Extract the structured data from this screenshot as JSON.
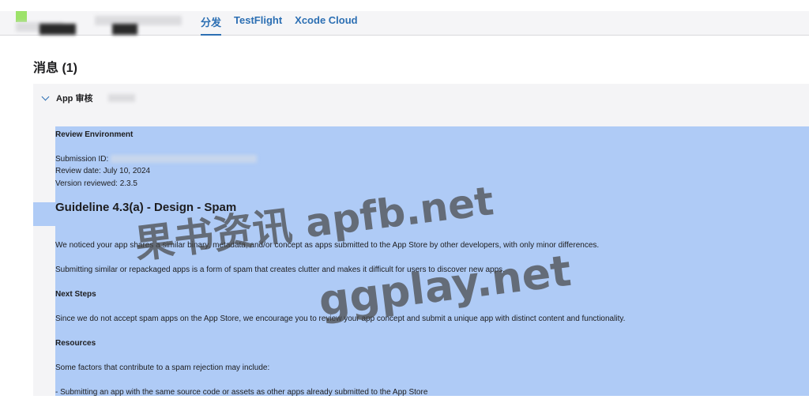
{
  "nav": {
    "tabs": [
      {
        "label": "分发",
        "active": true
      },
      {
        "label": "TestFlight",
        "active": false
      },
      {
        "label": "Xcode Cloud",
        "active": false
      }
    ]
  },
  "page_title": "消息 (1)",
  "section": {
    "header_label": "App 审核"
  },
  "message": {
    "env_heading": "Review Environment",
    "submission_id": "Submission ID: ",
    "review_date": "Review date: July 10, 2024",
    "version_reviewed": "Version reviewed: 2.3.5",
    "guideline_heading": "Guideline 4.3(a) - Design - Spam",
    "para1": "We noticed your app shares a similar binary, metadata, and/or concept as apps submitted to the App Store by other developers, with only minor differences.",
    "para2": "Submitting similar or repackaged apps is a form of spam that creates clutter and makes it difficult for users to discover new apps.",
    "next_steps_heading": "Next Steps",
    "para3": "Since we do not accept spam apps on the App Store, we encourage you to review your app concept and submit a unique app with distinct content and functionality.",
    "resources_heading": "Resources",
    "para4": "Some factors that contribute to a spam rejection may include:",
    "bullet1": "- Submitting an app with the same source code or assets as other apps already submitted to the App Store"
  },
  "watermark": {
    "line1": "果书资讯 apfb.net",
    "line2": "ggplay.net"
  },
  "colors": {
    "accent": "#2c6fb3",
    "selection": "#afcbf6",
    "logo": "#9de26a"
  }
}
